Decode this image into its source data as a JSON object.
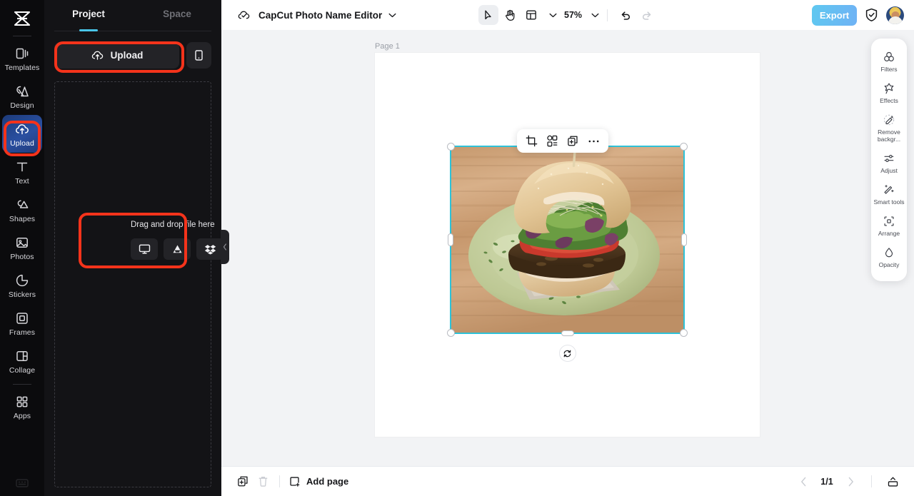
{
  "rail": {
    "logo_icon": "capcut-logo-icon",
    "items": [
      {
        "label": "Templates",
        "icon": "templates-icon",
        "active": false
      },
      {
        "label": "Design",
        "icon": "design-icon",
        "active": false
      },
      {
        "label": "Upload",
        "icon": "upload-cloud-icon",
        "active": true
      },
      {
        "label": "Text",
        "icon": "text-icon",
        "active": false
      },
      {
        "label": "Shapes",
        "icon": "shapes-icon",
        "active": false
      },
      {
        "label": "Photos",
        "icon": "photos-icon",
        "active": false
      },
      {
        "label": "Stickers",
        "icon": "stickers-icon",
        "active": false
      },
      {
        "label": "Frames",
        "icon": "frames-icon",
        "active": false
      },
      {
        "label": "Collage",
        "icon": "collage-icon",
        "active": false
      },
      {
        "label": "Apps",
        "icon": "apps-grid-icon",
        "active": false
      }
    ],
    "bottom_icon": "keyboard-shortcuts-icon"
  },
  "panel": {
    "tabs": [
      {
        "label": "Project",
        "active": true
      },
      {
        "label": "Space",
        "active": false
      }
    ],
    "upload_label": "Upload",
    "upload_icon": "upload-cloud-icon",
    "mobile_icon": "mobile-phone-icon",
    "dropzone": {
      "label": "Drag and drop file here",
      "sources": [
        {
          "name": "computer",
          "icon": "monitor-icon"
        },
        {
          "name": "google-drive",
          "icon": "google-drive-icon"
        },
        {
          "name": "dropbox",
          "icon": "dropbox-icon"
        }
      ]
    },
    "collapse_icon": "chevron-left-icon"
  },
  "topbar": {
    "cloud_icon": "cloud-saved-icon",
    "title": "CapCut Photo Name Editor",
    "title_caret_icon": "chevron-down-icon",
    "tools": [
      {
        "name": "select-tool",
        "icon": "cursor-arrow-icon",
        "active": true
      },
      {
        "name": "hand-tool",
        "icon": "hand-icon",
        "active": false
      },
      {
        "name": "layout-tool",
        "icon": "layout-grid-icon",
        "active": false
      }
    ],
    "layout_caret_icon": "chevron-down-icon",
    "zoom_value": "57%",
    "zoom_caret_icon": "chevron-down-icon",
    "undo_icon": "undo-icon",
    "redo_icon": "redo-icon",
    "undo_enabled": true,
    "redo_enabled": false,
    "export_label": "Export",
    "shield_icon": "shield-check-icon",
    "avatar_name": "user-avatar"
  },
  "canvas": {
    "page_label": "Page 1",
    "element_toolbar": [
      {
        "name": "crop-button",
        "icon": "crop-icon"
      },
      {
        "name": "cutout-button",
        "icon": "cutout-shapes-icon"
      },
      {
        "name": "duplicate-button",
        "icon": "add-layer-icon"
      },
      {
        "name": "more-options-button",
        "icon": "ellipsis-icon"
      }
    ],
    "selected_image_alt": "veggie burger on green plate on wooden table",
    "rotate_icon": "rotate-icon"
  },
  "dock": {
    "items": [
      {
        "label": "Filters",
        "icon": "filters-icon"
      },
      {
        "label": "Effects",
        "icon": "effects-star-icon"
      },
      {
        "label": "Remove backgr...",
        "icon": "remove-background-icon"
      },
      {
        "label": "Adjust",
        "icon": "adjust-sliders-icon"
      },
      {
        "label": "Smart tools",
        "icon": "smart-tools-wand-icon"
      },
      {
        "label": "Arrange",
        "icon": "arrange-icon"
      },
      {
        "label": "Opacity",
        "icon": "opacity-drop-icon"
      }
    ]
  },
  "bottombar": {
    "duplicate_page_icon": "duplicate-page-icon",
    "delete_page_icon": "trash-icon",
    "add_page_label": "Add page",
    "add_page_icon": "add-page-icon",
    "prev_icon": "chevron-left-icon",
    "page_indicator": "1/1",
    "next_icon": "chevron-right-icon",
    "expand_icon": "expand-panel-icon"
  },
  "colors": {
    "highlight": "#f4331b",
    "accent_cyan": "#49c5e8",
    "selection": "#2ec2d8",
    "rail_bg": "#0b0b0d",
    "panel_bg": "#131316",
    "canvas_bg": "#f2f3f5"
  }
}
